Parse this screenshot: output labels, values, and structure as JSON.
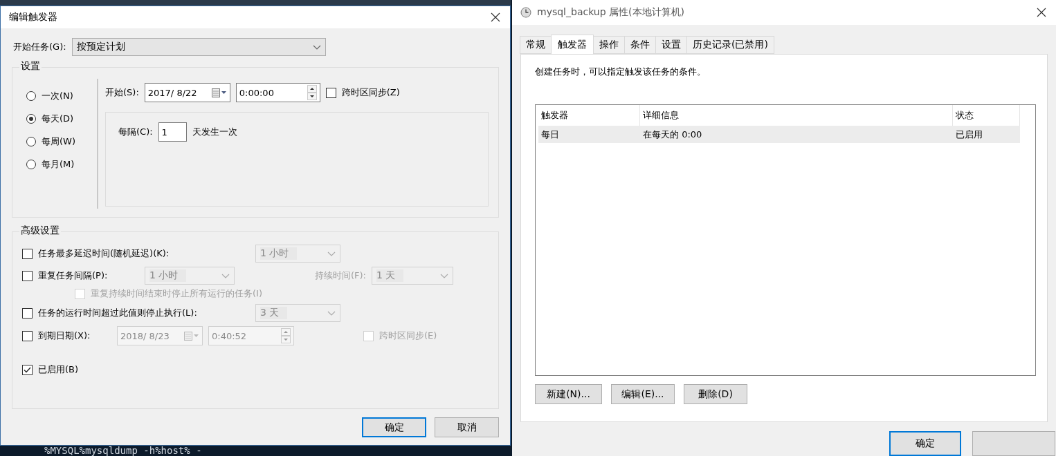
{
  "background_terminal": {
    "text": "%MYSQL%mysqldump -h%host% -"
  },
  "edit_trigger_dialog": {
    "title": "编辑触发器",
    "begin_task": {
      "label": "开始任务(G):",
      "value": "按预定计划"
    },
    "settings": {
      "title": "设置",
      "schedule_options": [
        {
          "label": "一次(N)",
          "selected": false
        },
        {
          "label": "每天(D)",
          "selected": true
        },
        {
          "label": "每周(W)",
          "selected": false
        },
        {
          "label": "每月(M)",
          "selected": false
        }
      ],
      "start": {
        "label": "开始(S):",
        "date": "2017/  8/22",
        "time": "0:00:00",
        "sync_timezone": {
          "label": "跨时区同步(Z)",
          "checked": false
        }
      },
      "recur": {
        "label": "每隔(C):",
        "value": "1",
        "suffix": "天发生一次"
      }
    },
    "advanced": {
      "title": "高级设置",
      "delay": {
        "label": "任务最多延迟时间(随机延迟)(K):",
        "checked": false,
        "value": "1 小时"
      },
      "repeat": {
        "label": "重复任务间隔(P):",
        "checked": false,
        "value": "1 小时",
        "duration_label": "持续时间(F):",
        "duration_value": "1 天",
        "duration_disabled": true
      },
      "stop_all": {
        "label": "重复持续时间结束时停止所有运行的任务(I)",
        "checked": false,
        "disabled": true
      },
      "stop_after": {
        "label": "任务的运行时间超过此值则停止执行(L):",
        "checked": false,
        "value": "3 天"
      },
      "expire": {
        "label": "到期日期(X):",
        "checked": false,
        "date": "2018/  8/23",
        "time": "0:40:52",
        "sync": {
          "label": "跨时区同步(E)",
          "checked": false,
          "disabled": true
        }
      },
      "enabled": {
        "label": "已启用(B)",
        "checked": true
      }
    },
    "buttons": [
      {
        "label": "确定",
        "default": true
      },
      {
        "label": "取消",
        "default": false
      }
    ]
  },
  "properties_dialog": {
    "title": "mysql_backup 属性(本地计算机)",
    "tabs": [
      {
        "label": "常规",
        "selected": false
      },
      {
        "label": "触发器",
        "selected": true
      },
      {
        "label": "操作",
        "selected": false
      },
      {
        "label": "条件",
        "selected": false
      },
      {
        "label": "设置",
        "selected": false
      },
      {
        "label": "历史记录(已禁用)",
        "selected": false
      }
    ],
    "description": "创建任务时，可以指定触发该任务的条件。",
    "table": {
      "columns": [
        "触发器",
        "详细信息",
        "状态"
      ],
      "rows": [
        {
          "cells": [
            "每日",
            "在每天的 0:00",
            "已启用"
          ],
          "selected": true
        }
      ]
    },
    "buttons": [
      "新建(N)...",
      "编辑(E)...",
      "删除(D)"
    ],
    "footer_buttons": [
      {
        "label": "确定",
        "default": true
      }
    ]
  }
}
